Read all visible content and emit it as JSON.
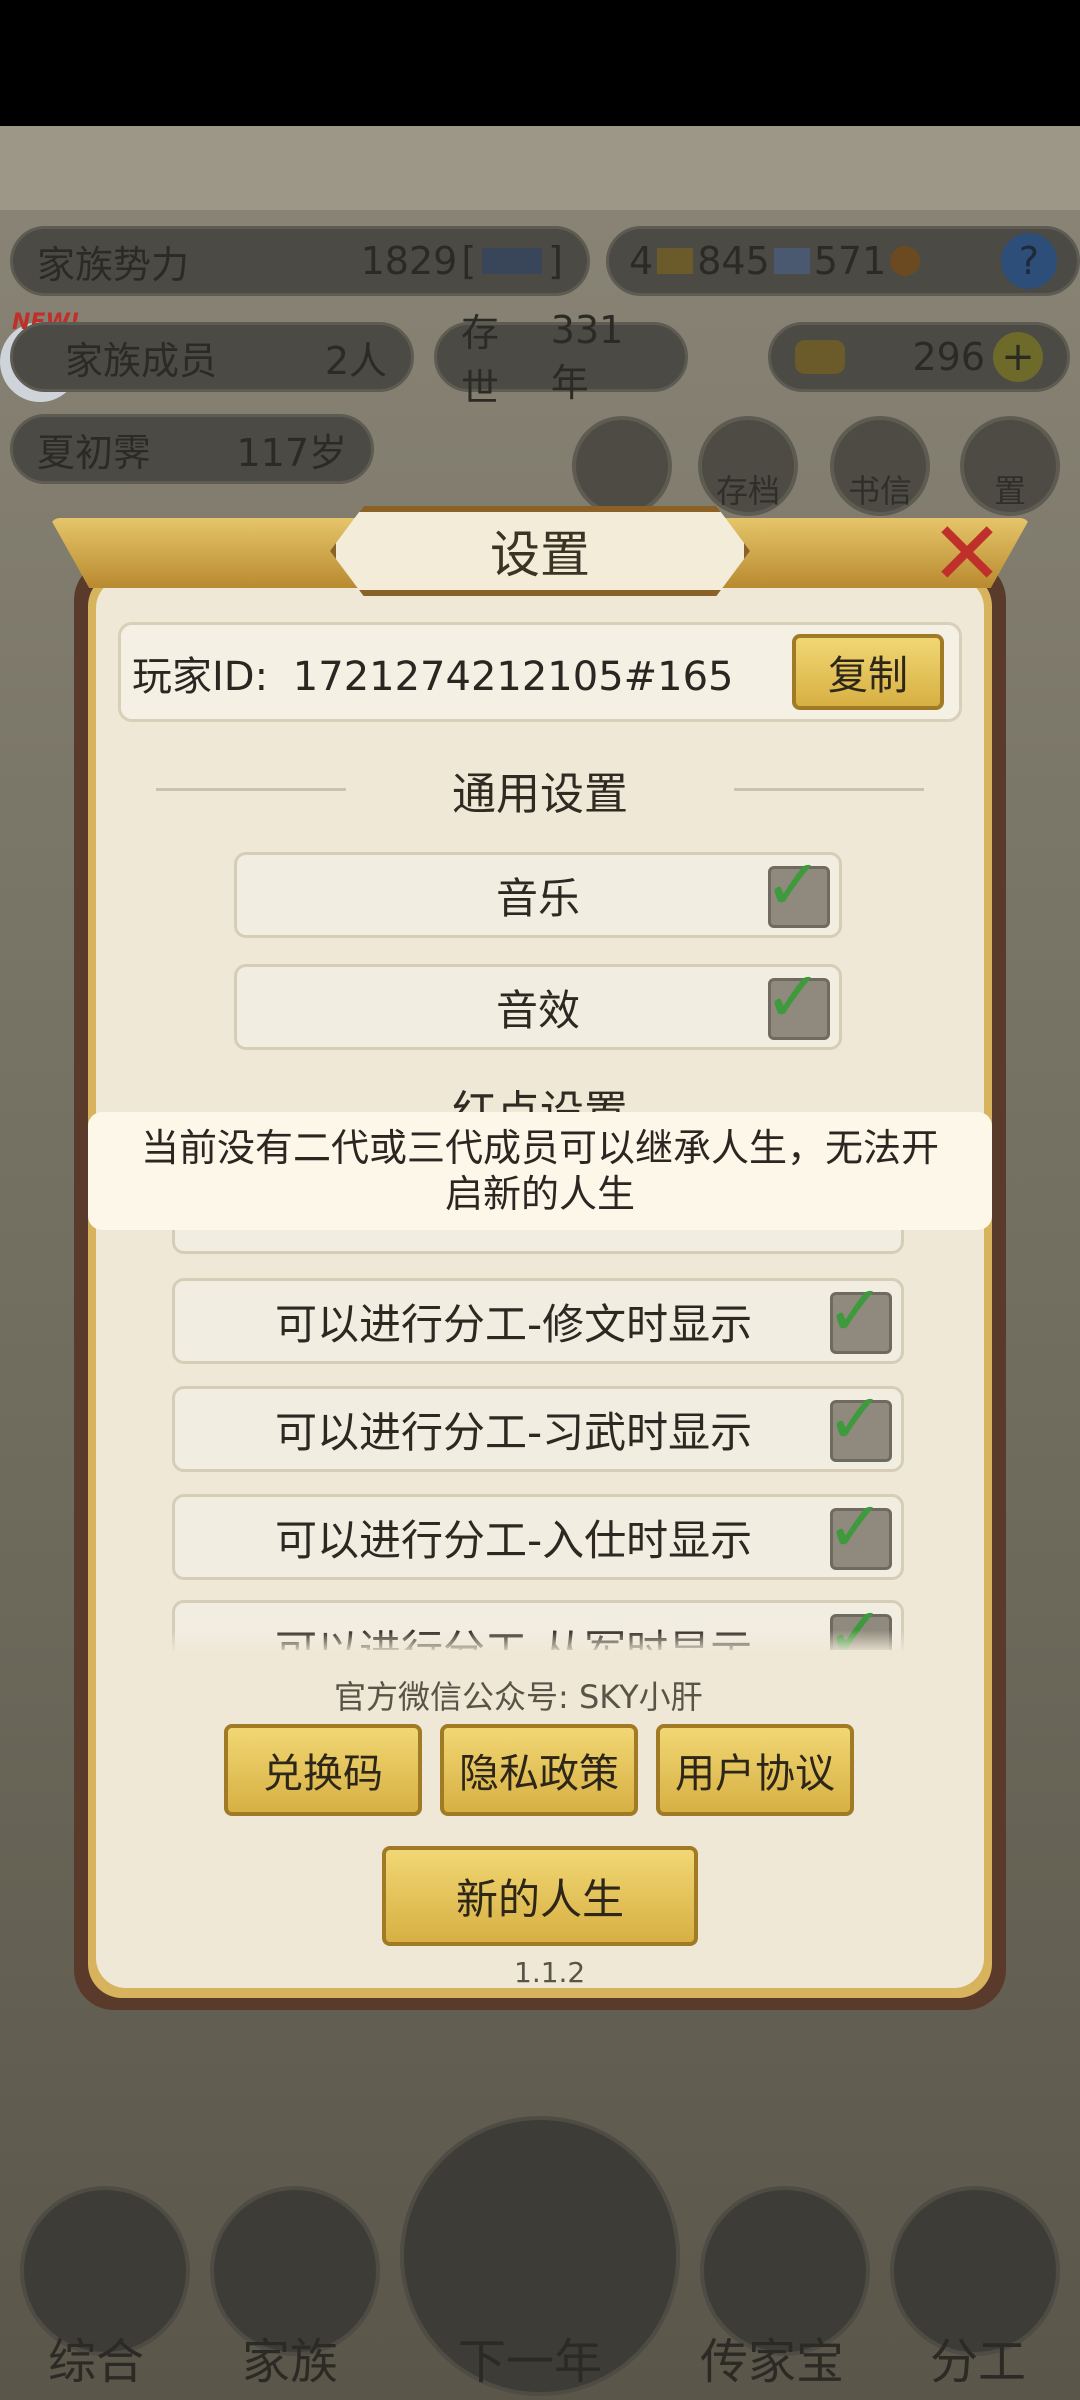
{
  "hud": {
    "family_power_label": "家族势力",
    "family_power_value": "1829",
    "bracket_open": "[",
    "bracket_close": "]",
    "res1": "4",
    "res2": "845",
    "res3": "571",
    "help": "?",
    "new_badge": "NEW!",
    "members_label": "家族成员",
    "members_value": "2人",
    "alive_label": "存世",
    "alive_value": "331年",
    "gold_value": "296",
    "plus": "+",
    "person_name": "夏初霁",
    "person_age": "117岁",
    "circle_labels": [
      "",
      "存档",
      "书信",
      "置"
    ]
  },
  "bottom_nav": [
    "综合",
    "家族",
    "下一年",
    "传家宝",
    "分工"
  ],
  "dialog": {
    "title": "设置",
    "close_icon": "close-x-icon",
    "player_id_label": "玩家ID:",
    "player_id_value": "1721274212105#165",
    "copy_button": "复制",
    "general_section": "通用设置",
    "music_label": "音乐",
    "sfx_label": "音效",
    "reddot_section": "红点设置",
    "rows": [
      "可以进行分工-修文时显示",
      "可以进行分工-习武时显示",
      "可以进行分工-入仕时显示",
      "可以进行分工-从军时显示"
    ],
    "official_account": "官方微信公众号: SKY小肝",
    "redeem_button": "兑换码",
    "privacy_button": "隐私政策",
    "agreement_button": "用户协议",
    "new_life_button": "新的人生",
    "version": "1.1.2"
  },
  "toast": {
    "message": "当前没有二代或三代成员可以继承人生，无法开启新的人生"
  },
  "colors": {
    "check_green": "#3f9a3e",
    "gold_button": "#d7b043",
    "close_red": "#c0302a"
  }
}
